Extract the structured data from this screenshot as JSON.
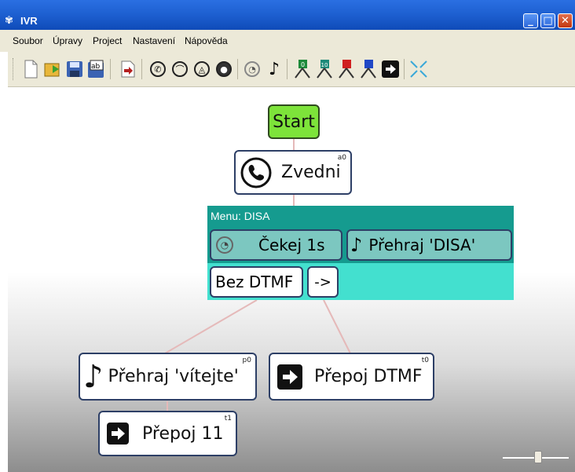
{
  "window": {
    "title": "IVR"
  },
  "menu": [
    "Soubor",
    "Úpravy",
    "Project",
    "Nastavení",
    "Nápověda"
  ],
  "toolbar": {
    "buttons": [
      "new-document-icon",
      "open-folder-icon",
      "save-icon",
      "save-as-icon",
      "export-icon",
      "phone-answer-icon",
      "hangup-icon",
      "alarm-icon",
      "bell-icon",
      "clock-icon",
      "music-note-icon",
      "dtmf-0-icon",
      "dtmf-10-icon",
      "dtmf-red-icon",
      "dtmf-blue-icon",
      "transfer-icon",
      "collapse-icon"
    ],
    "dtmf_0_label": "0",
    "dtmf_10_label": "10"
  },
  "nodes": {
    "start": {
      "label": "Start"
    },
    "answer": {
      "label": "Zvedni",
      "tag": "a0"
    },
    "menu": {
      "title": "Menu: DISA",
      "wait": "Čekej 1s",
      "play": "Přehraj 'DISA'",
      "no_dtmf": "Bez DTMF",
      "arrow": "->"
    },
    "play_welcome": {
      "label": "Přehraj 'vítejte'",
      "tag": "p0"
    },
    "transfer_dtmf": {
      "label": "Přepoj DTMF",
      "tag": "t0"
    },
    "transfer_11": {
      "label": "Přepoj 11",
      "tag": "t1"
    }
  },
  "colors": {
    "start_fill": "#7de33a",
    "menu_header": "#159b8f",
    "menu_body": "#43e0cf",
    "connector": "#e5b9b9"
  }
}
